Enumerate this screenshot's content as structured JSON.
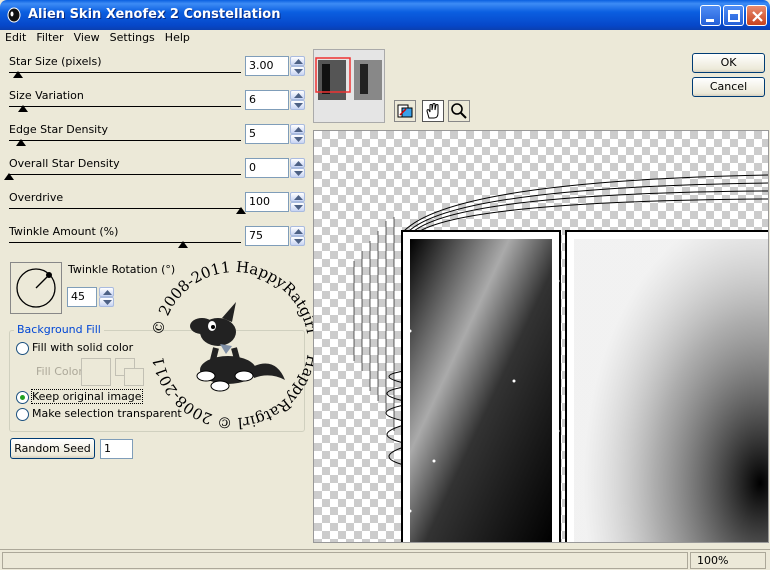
{
  "window": {
    "title": "Alien Skin Xenofex 2 Constellation",
    "buttons": {
      "minimize": "minimize",
      "maximize": "maximize",
      "close": "close"
    }
  },
  "menu": [
    "Edit",
    "Filter",
    "View",
    "Settings",
    "Help"
  ],
  "controls": {
    "star_size": {
      "label": "Star Size (pixels)",
      "value": "3.00",
      "slider_fraction": 0.04
    },
    "size_variation": {
      "label": "Size Variation",
      "value": "6",
      "slider_fraction": 0.06
    },
    "edge_star_density": {
      "label": "Edge Star Density",
      "value": "5",
      "slider_fraction": 0.05
    },
    "overall_star_density": {
      "label": "Overall Star Density",
      "value": "0",
      "slider_fraction": 0.0
    },
    "overdrive": {
      "label": "Overdrive",
      "value": "100",
      "slider_fraction": 1.0
    },
    "twinkle_amount": {
      "label": "Twinkle Amount (%)",
      "value": "75",
      "slider_fraction": 0.75
    },
    "twinkle_rotation": {
      "label": "Twinkle Rotation (°)",
      "value": "45"
    }
  },
  "background_fill": {
    "title": "Background Fill",
    "options": [
      "Fill with solid color",
      "Keep original image",
      "Make selection transparent"
    ],
    "selected": "Keep original image",
    "fill_color_label": "Fill Color"
  },
  "random_seed": {
    "label": "Random Seed",
    "value": "1"
  },
  "dialog_buttons": {
    "ok": "OK",
    "cancel": "Cancel"
  },
  "tools": [
    "compare-icon",
    "hand-icon",
    "magnifier-icon"
  ],
  "status": {
    "zoom": "100%"
  },
  "watermark": {
    "text_top": "© 2008-2011 HappyRatgirl",
    "text_bottom": "HappyRatgirl © 2008-2011"
  },
  "colors": {
    "titlebar": "#0a5fe0",
    "accent": "#0046d5",
    "radio_checked": "#21a121"
  }
}
